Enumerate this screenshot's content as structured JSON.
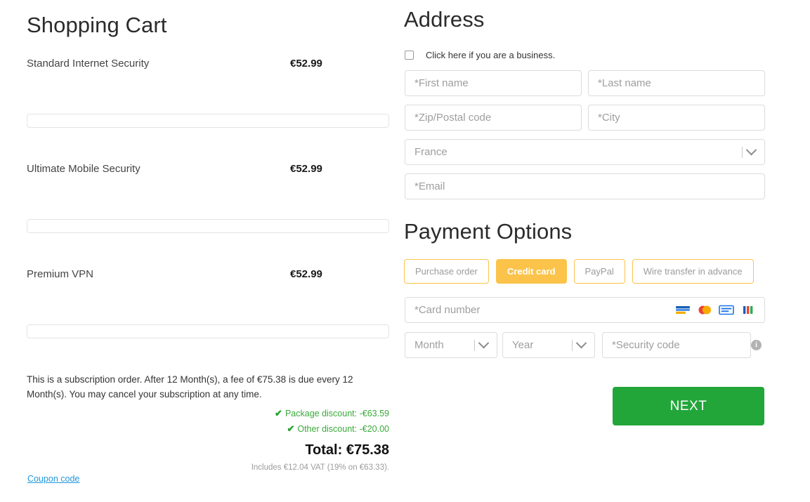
{
  "cart": {
    "title": "Shopping Cart",
    "items": [
      {
        "name": "Standard Internet Security",
        "price": "€52.99"
      },
      {
        "name": "Ultimate Mobile Security",
        "price": "€52.99"
      },
      {
        "name": "Premium VPN",
        "price": "€52.99"
      }
    ],
    "subscription_note": "This is a subscription order. After 12 Month(s), a fee of €75.38 is due every 12 Month(s). You may cancel your subscription at any time.",
    "discounts": [
      {
        "label": "Package discount:",
        "amount": "-€63.59"
      },
      {
        "label": "Other discount:",
        "amount": "-€20.00"
      }
    ],
    "total_label": "Total:",
    "total_amount": "€75.38",
    "vat_note": "Includes €12.04 VAT (19% on €63.33).",
    "coupon_link": "Coupon code"
  },
  "address": {
    "title": "Address",
    "business_checkbox_label": "Click here if you are a business.",
    "fields": {
      "first_name": "*First name",
      "last_name": "*Last name",
      "zip": "*Zip/Postal code",
      "city": "*City",
      "country": "France",
      "email": "*Email"
    }
  },
  "payment": {
    "title": "Payment Options",
    "methods": [
      {
        "label": "Purchase order",
        "active": false
      },
      {
        "label": "Credit card",
        "active": true
      },
      {
        "label": "PayPal",
        "active": false
      },
      {
        "label": "Wire transfer in advance",
        "active": false
      }
    ],
    "card_number": "*Card number",
    "card_brands": [
      "visa-icon",
      "mastercard-icon",
      "amex-icon",
      "other-card-icon"
    ],
    "month": "Month",
    "year": "Year",
    "security_code": "*Security code",
    "security_info_icon": "info-icon",
    "next_button": "NEXT"
  },
  "colors": {
    "accent": "#fbc34a",
    "success": "#22a63a",
    "discount_green": "#3aa93a",
    "link_blue": "#2196dd",
    "field_border": "#dcdcdc"
  }
}
